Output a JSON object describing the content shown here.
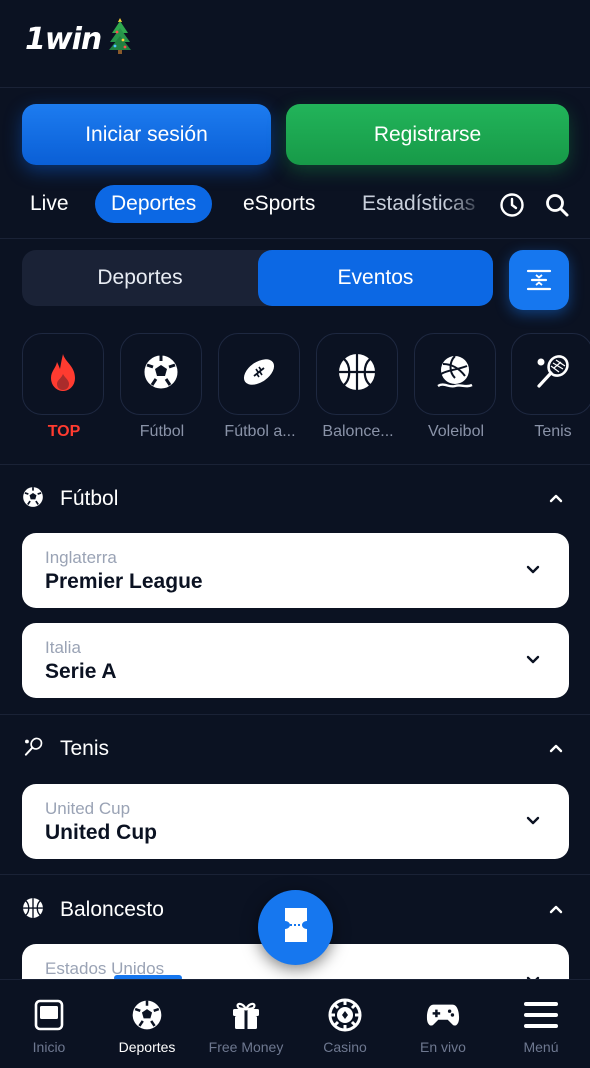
{
  "header": {
    "logo_text": "1win"
  },
  "auth": {
    "login_label": "Iniciar sesión",
    "register_label": "Registrarse"
  },
  "nav_tabs": [
    {
      "label": "Live"
    },
    {
      "label": "Deportes",
      "active": true
    },
    {
      "label": "eSports"
    },
    {
      "label": "Estadísticas"
    }
  ],
  "segment": {
    "sports_label": "Deportes",
    "events_label": "Eventos",
    "active": "Eventos"
  },
  "categories": [
    {
      "label": "TOP",
      "icon": "fire-icon"
    },
    {
      "label": "Fútbol",
      "icon": "soccer-ball-icon"
    },
    {
      "label": "Fútbol a...",
      "icon": "american-football-icon"
    },
    {
      "label": "Balonce...",
      "icon": "basketball-icon"
    },
    {
      "label": "Voleibol",
      "icon": "volleyball-icon"
    },
    {
      "label": "Tenis",
      "icon": "tennis-racket-icon"
    }
  ],
  "sections": [
    {
      "title": "Fútbol",
      "icon": "soccer-ball-icon",
      "leagues": [
        {
          "country": "Inglaterra",
          "name": "Premier League"
        },
        {
          "country": "Italia",
          "name": "Serie A"
        }
      ]
    },
    {
      "title": "Tenis",
      "icon": "tennis-racket-icon",
      "leagues": [
        {
          "country": "United Cup",
          "name": "United Cup"
        }
      ]
    },
    {
      "title": "Baloncesto",
      "icon": "basketball-icon",
      "leagues": [
        {
          "country": "Estados Unidos",
          "name": ""
        }
      ]
    }
  ],
  "bottom_nav": [
    {
      "label": "Inicio",
      "icon": "home-icon"
    },
    {
      "label": "Deportes",
      "icon": "soccer-ball-icon",
      "active": true
    },
    {
      "label": "Free Money",
      "icon": "gift-icon"
    },
    {
      "label": "Casino",
      "icon": "casino-chip-icon"
    },
    {
      "label": "En vivo",
      "icon": "gamepad-icon"
    },
    {
      "label": "Menú",
      "icon": "menu-icon"
    }
  ],
  "colors": {
    "background": "#0b1222",
    "primary": "#1677ef",
    "success": "#1ea653",
    "top": "#ff3b30"
  }
}
